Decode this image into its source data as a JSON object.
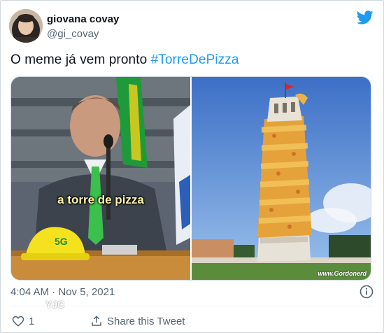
{
  "author": {
    "name": "giovana covay",
    "handle": "@gi_covay"
  },
  "tweet": {
    "text": "O meme já vem pronto ",
    "hashtag": "#TorreDePizza"
  },
  "media": {
    "caption": "a torre de pizza",
    "cap_text": "5G",
    "watermark": "www.Gordonerd"
  },
  "meta": {
    "timestamp": "4:04 AM · Nov 5, 2021"
  },
  "actions": {
    "like_count": "1",
    "share_label": "Share this Tweet"
  },
  "overlay": {
    "logo_text": "YJC"
  },
  "colors": {
    "accent": "#1d9bf0",
    "text": "#0f1419",
    "muted": "#536471"
  },
  "icons": [
    "twitter-bird-icon",
    "info-icon",
    "heart-icon",
    "share-icon"
  ]
}
